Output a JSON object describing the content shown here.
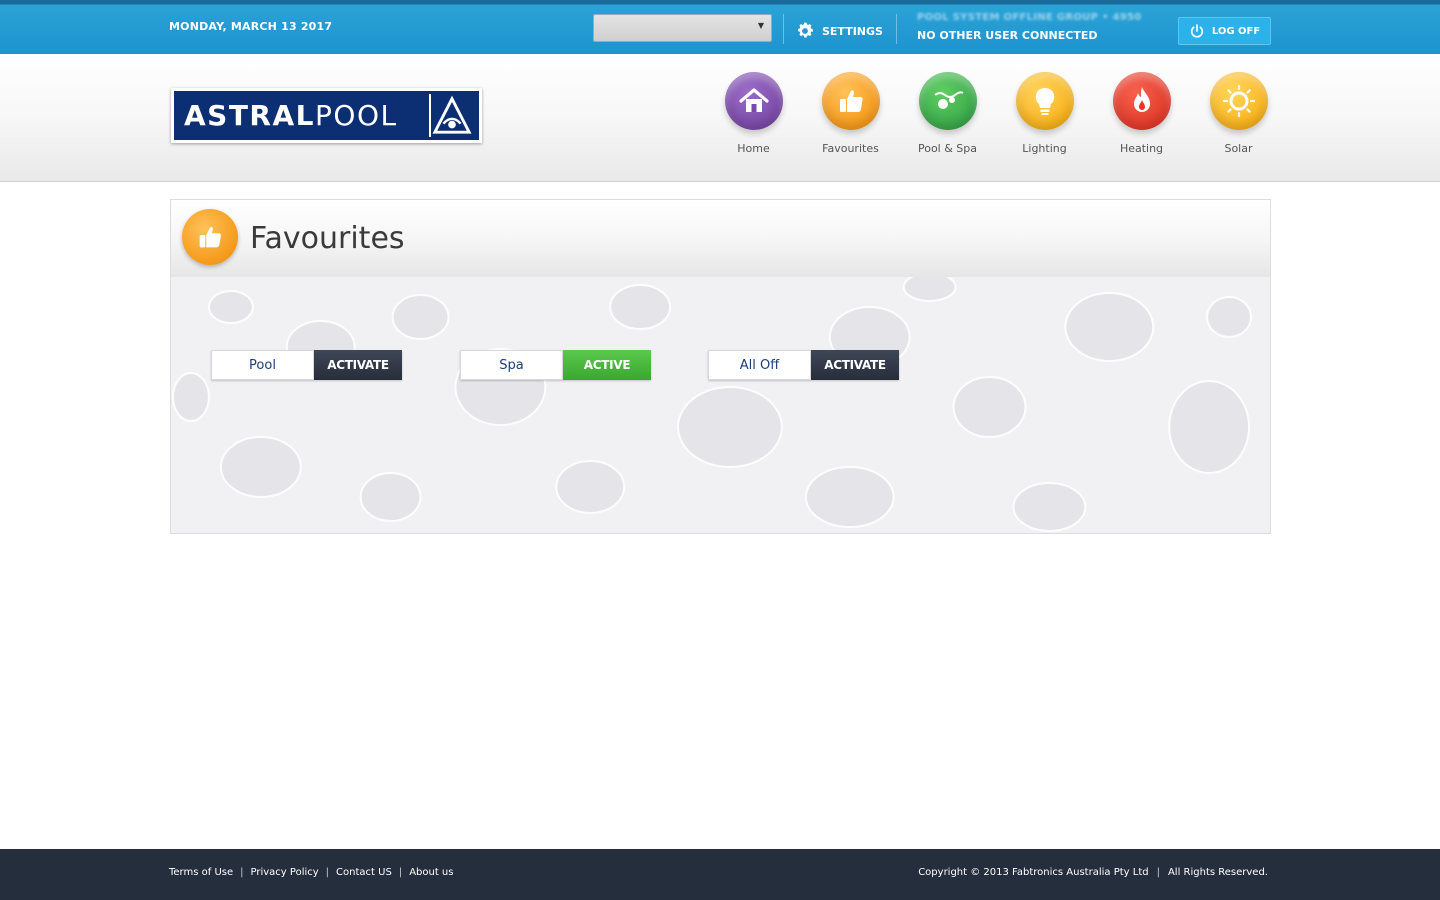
{
  "topbar": {
    "date": "MONDAY, MARCH 13 2017",
    "system_select_value": "",
    "settings_label": "SETTINGS",
    "system_name": "POOL SYSTEM OFFLINE GROUP • 4950",
    "connection_status": "NO OTHER USER CONNECTED",
    "logoff_label": "LOG OFF",
    "accent_color": "#1d93cf"
  },
  "brand": {
    "logo_bold": "ASTRAL",
    "logo_light": "POOL",
    "logo_color": "#0c2f73"
  },
  "nav": {
    "items": [
      {
        "label": "Home",
        "icon": "house-icon",
        "color": "#7b4aa8"
      },
      {
        "label": "Favourites",
        "icon": "thumbs-up-icon",
        "color": "#f59a1b"
      },
      {
        "label": "Pool & Spa",
        "icon": "pool-spa-icon",
        "color": "#3aa84a"
      },
      {
        "label": "Lighting",
        "icon": "lightbulb-icon",
        "color": "#f7b21a"
      },
      {
        "label": "Heating",
        "icon": "flame-icon",
        "color": "#e23a2a"
      },
      {
        "label": "Solar",
        "icon": "sun-icon",
        "color": "#f9b21b"
      }
    ]
  },
  "page": {
    "title": "Favourites",
    "title_icon": "thumbs-up-icon"
  },
  "favourites": [
    {
      "name": "Pool",
      "action": "ACTIVATE",
      "state": "inactive",
      "button_color": "#2e3444"
    },
    {
      "name": "Spa",
      "action": "ACTIVE",
      "state": "active",
      "button_color": "#4ab83d"
    },
    {
      "name": "All Off",
      "action": "ACTIVATE",
      "state": "inactive",
      "button_color": "#2e3444"
    }
  ],
  "footer": {
    "links": [
      "Terms of Use",
      "Privacy Policy",
      "Contact US",
      "About us"
    ],
    "copyright": "Copyright © 2013 Fabtronics Australia Pty Ltd",
    "rights": "All Rights Reserved."
  }
}
